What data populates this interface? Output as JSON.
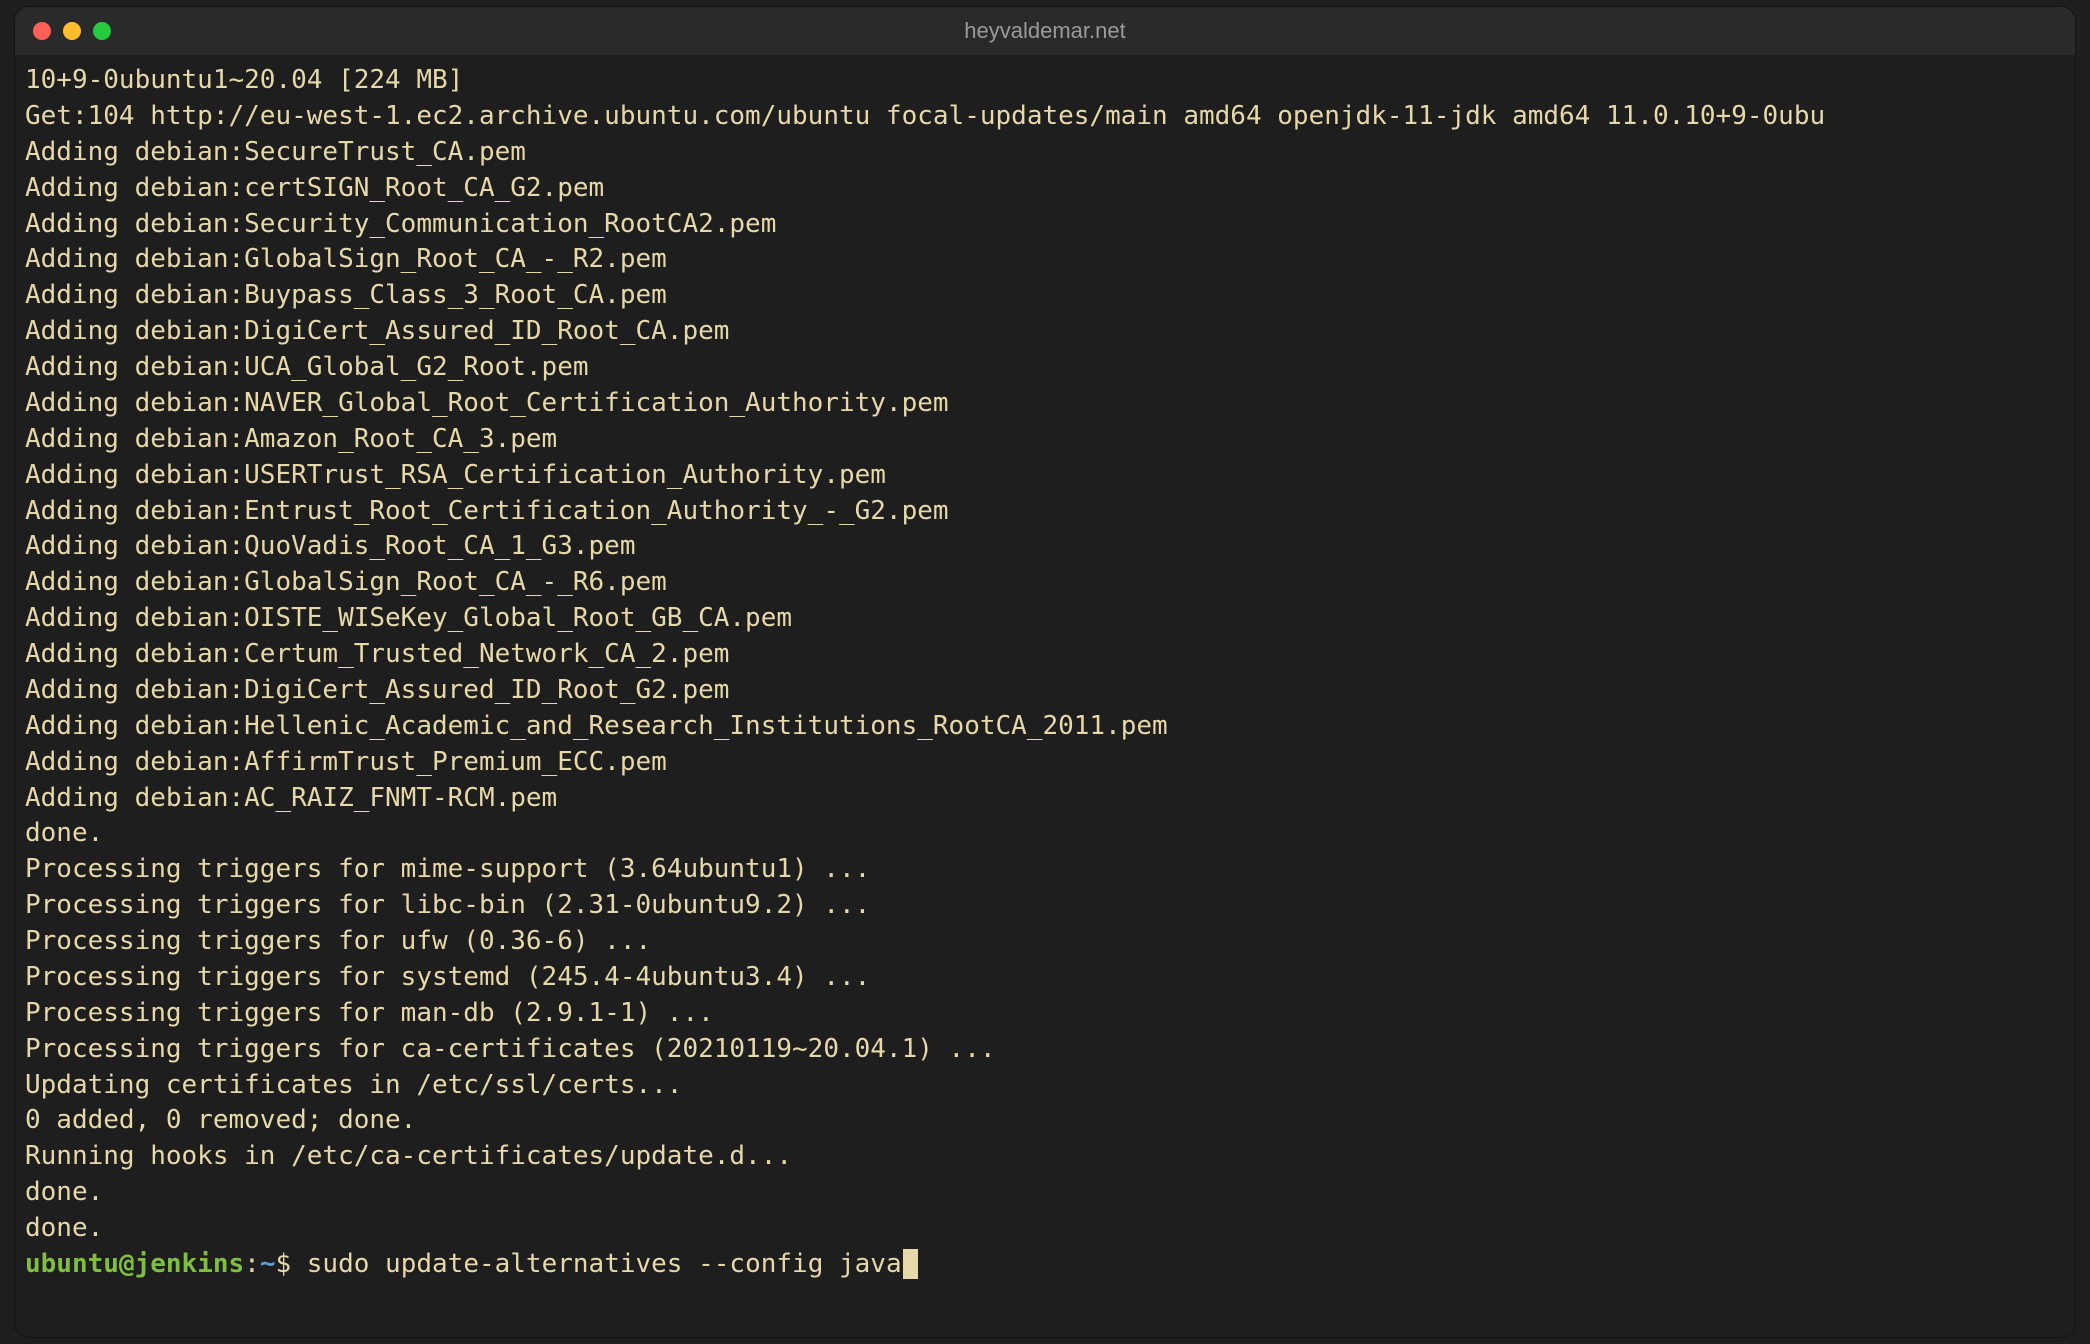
{
  "window": {
    "title": "heyvaldemar.net"
  },
  "terminal": {
    "lines": [
      "10+9-0ubuntu1~20.04 [224 MB]",
      "Get:104 http://eu-west-1.ec2.archive.ubuntu.com/ubuntu focal-updates/main amd64 openjdk-11-jdk amd64 11.0.10+9-0ubu",
      "Adding debian:SecureTrust_CA.pem",
      "Adding debian:certSIGN_Root_CA_G2.pem",
      "Adding debian:Security_Communication_RootCA2.pem",
      "Adding debian:GlobalSign_Root_CA_-_R2.pem",
      "Adding debian:Buypass_Class_3_Root_CA.pem",
      "Adding debian:DigiCert_Assured_ID_Root_CA.pem",
      "Adding debian:UCA_Global_G2_Root.pem",
      "Adding debian:NAVER_Global_Root_Certification_Authority.pem",
      "Adding debian:Amazon_Root_CA_3.pem",
      "Adding debian:USERTrust_RSA_Certification_Authority.pem",
      "Adding debian:Entrust_Root_Certification_Authority_-_G2.pem",
      "Adding debian:QuoVadis_Root_CA_1_G3.pem",
      "Adding debian:GlobalSign_Root_CA_-_R6.pem",
      "Adding debian:OISTE_WISeKey_Global_Root_GB_CA.pem",
      "Adding debian:Certum_Trusted_Network_CA_2.pem",
      "Adding debian:DigiCert_Assured_ID_Root_G2.pem",
      "Adding debian:Hellenic_Academic_and_Research_Institutions_RootCA_2011.pem",
      "Adding debian:AffirmTrust_Premium_ECC.pem",
      "Adding debian:AC_RAIZ_FNMT-RCM.pem",
      "done.",
      "Processing triggers for mime-support (3.64ubuntu1) ...",
      "Processing triggers for libc-bin (2.31-0ubuntu9.2) ...",
      "Processing triggers for ufw (0.36-6) ...",
      "Processing triggers for systemd (245.4-4ubuntu3.4) ...",
      "Processing triggers for man-db (2.9.1-1) ...",
      "Processing triggers for ca-certificates (20210119~20.04.1) ...",
      "Updating certificates in /etc/ssl/certs...",
      "0 added, 0 removed; done.",
      "Running hooks in /etc/ca-certificates/update.d...",
      "",
      "done.",
      "done."
    ],
    "prompt": {
      "user": "ubuntu",
      "host": "jenkins",
      "path": "~",
      "symbol": "$",
      "command": "sudo update-alternatives --config java"
    }
  }
}
